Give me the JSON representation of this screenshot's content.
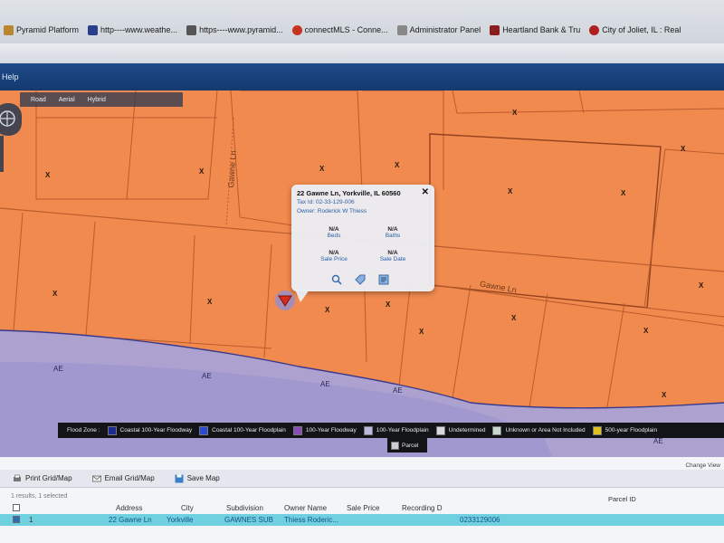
{
  "bookmarks": [
    {
      "label": "Pyramid Platform",
      "color": "#b8862e"
    },
    {
      "label": "http----www.weathe...",
      "color": "#2a3e8c"
    },
    {
      "label": "https----www.pyramid...",
      "color": "#555555"
    },
    {
      "label": "connectMLS - Conne...",
      "color": "#c8321e"
    },
    {
      "label": "Administrator Panel",
      "color": "#888888"
    },
    {
      "label": "Heartland Bank & Tru",
      "color": "#8a1e1e"
    },
    {
      "label": "City of Joliet, IL : Real",
      "color": "#b02020"
    }
  ],
  "app": {
    "help_label": "Help"
  },
  "map": {
    "tabs": [
      "Road",
      "Aerial",
      "Hybrid"
    ],
    "street_labels": [
      "Gawne Ln",
      "Gawne Ln"
    ],
    "flood_marks": [
      "X",
      "AE"
    ]
  },
  "popup": {
    "address": "22 Gawne Ln, Yorkville, IL 60560",
    "tax_id": "Tax Id: 02-33-129-006",
    "owner": "Owner: Roderick W Thiess",
    "beds_value": "N/A",
    "beds_label": "Beds",
    "baths_value": "N/A",
    "baths_label": "Baths",
    "price_value": "N/A",
    "price_label": "Sale Price",
    "date_value": "N/A",
    "date_label": "Sale Date"
  },
  "legend": {
    "title": "Flood Zone :",
    "items": [
      {
        "label": "Coastal 100-Year Floodway",
        "color": "#1c2a8c"
      },
      {
        "label": "Coastal 100-Year Floodplain",
        "color": "#2c4ad0"
      },
      {
        "label": "100-Year Floodway",
        "color": "#8a4bb8"
      },
      {
        "label": "100-Year Floodplain",
        "color": "#b8b8e0"
      },
      {
        "label": "Undetermined",
        "color": "#d8d8d8"
      },
      {
        "label": "Unknown or Area Not Included",
        "color": "#c8d8d0"
      },
      {
        "label": "500-year Floodplain",
        "color": "#e0c020"
      }
    ],
    "parcel_label": "Parcel"
  },
  "panel": {
    "change_view": "Change View",
    "toolbar": {
      "print": "Print Grid/Map",
      "email": "Email Grid/Map",
      "save": "Save Map"
    },
    "result_count": "1 results, 1 selected",
    "columns": {
      "address": "Address",
      "city": "City",
      "subdivision": "Subdivision",
      "owner": "Owner Name",
      "sale_price": "Sale Price",
      "recording": "Recording D",
      "parcel": "Parcel ID"
    },
    "row": {
      "num": "1",
      "address": "22 Gawne Ln",
      "city": "Yorkville",
      "subdivision": "GAWNES SUB",
      "owner": "Thiess Roderic...",
      "sale_price": "",
      "recording": "",
      "parcel": "0233129006"
    }
  }
}
